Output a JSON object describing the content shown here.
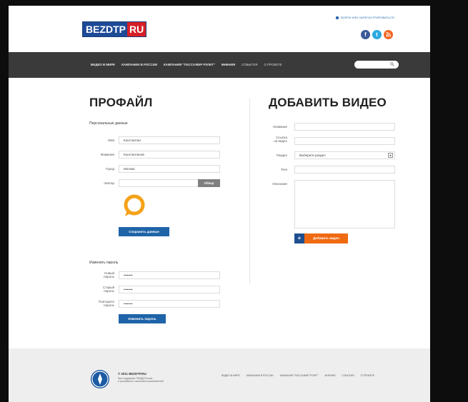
{
  "header": {
    "logo_part1": "BEZDTP",
    "logo_part2": "RU",
    "login_link": "ВОЙТИ ИЛИ ЗАРЕГИСТРИРОВАТЬСЯ",
    "social": [
      {
        "icon": "facebook-icon",
        "glyph": "f"
      },
      {
        "icon": "twitter-icon",
        "glyph": "t"
      },
      {
        "icon": "rss-icon",
        "glyph": "◣"
      }
    ]
  },
  "nav": {
    "items": [
      "ВИДЕО В МИРЕ",
      "КАМПАНИИ В РОССИИ",
      "КАМПАНИЯ \"ПАССАЖИР РУЛИТ\"",
      "МНЕНИЯ",
      "СОБЫТИЯ",
      "О ПРОЕКТЕ"
    ],
    "search_icon": "search-icon"
  },
  "profile": {
    "title": "ПРОФАЙЛ",
    "personal_heading": "Персональные данные",
    "fields": [
      {
        "label": "Имя",
        "value": "Константин"
      },
      {
        "label": "Фамилия",
        "value": "Константинов"
      },
      {
        "label": "Город",
        "value": "Москва"
      },
      {
        "label": "Аватар",
        "value": ""
      }
    ],
    "browse_label": "Обзор",
    "avatar_icon": "chat-bubble-icon",
    "save_label": "Сохранить данные",
    "password_heading": "Изменить пароль",
    "password_fields": [
      {
        "label_line1": "Новый",
        "label_line2": "пароль",
        "value": "••••••••"
      },
      {
        "label_line1": "Старый",
        "label_line2": "пароль",
        "value": "••••••••"
      },
      {
        "label_line1": "Повторите",
        "label_line2": "пароль",
        "value": "••••••••"
      }
    ],
    "change_label": "Изменить пароль"
  },
  "video": {
    "title": "ДОБАВИТЬ ВИДЕО",
    "name_label": "Название",
    "link_label_line1": "Ссылка",
    "link_label_line2": "на видео",
    "section_label": "Раздел",
    "section_value": "Выберите раздел",
    "tags_label": "Теги",
    "desc_label": "Описание",
    "add_label": "Добавить видео",
    "plus_glyph": "+"
  },
  "footer": {
    "copyright": "© 2011 BEZDTP.RU",
    "sub_line1": "При поддержке ГИБДД России",
    "sub_line2": "и российского союза автострахователей",
    "links": [
      "ВИДЕО В МИРЕ",
      "КАМПАНИИ В РОССИИ",
      "КАМПАНИЯ \"ПАССАЖИР РУЛИТ\"",
      "МНЕНИЯ",
      "СОБЫТИЯ",
      "О ПРОЕКТЕ"
    ]
  },
  "colors": {
    "nav_bg": "#3a3a3a",
    "primary_blue": "#1f64a8",
    "accent_orange": "#f06a12",
    "logo_blue": "#1e4a96",
    "logo_red": "#d52027"
  }
}
